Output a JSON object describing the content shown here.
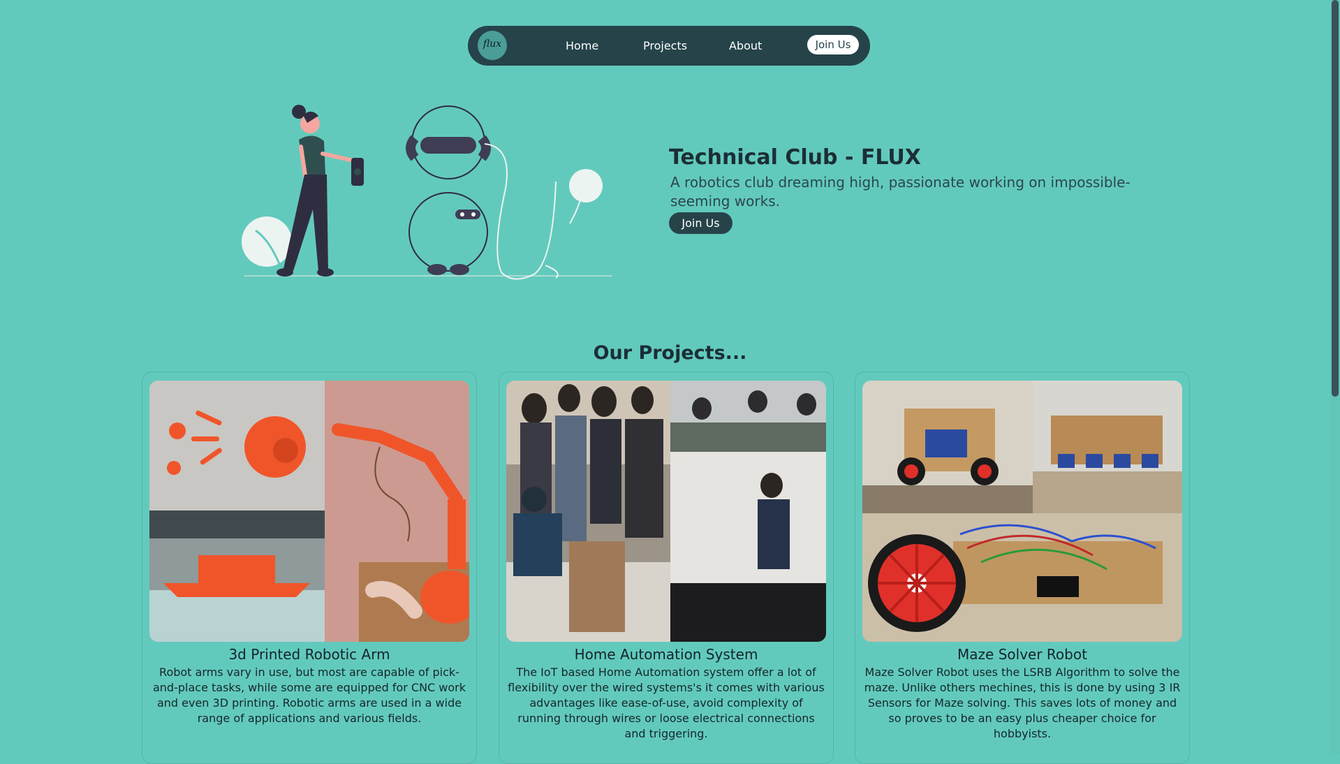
{
  "nav": {
    "logo_text": "flux",
    "links": [
      "Home",
      "Projects",
      "About"
    ],
    "join_label": "Join Us"
  },
  "hero": {
    "title": "Technical Club - FLUX",
    "subtitle": "A robotics club dreaming high, passionate working on impossible-seeming works.",
    "button_label": "Join Us"
  },
  "projects": {
    "heading": "Our Projects...",
    "cards": [
      {
        "title": "3d Printed Robotic Arm",
        "description": "Robot arms vary in use, but most are capable of pick-and-place tasks, while some are equipped for CNC work and even 3D printing. Robotic arms are used in a wide range of applications and various fields."
      },
      {
        "title": "Home Automation System",
        "description": "The IoT based Home Automation system offer a lot of flexibility over the wired systems's it comes with various advantages like ease-of-use, avoid complexity of running through wires or loose electrical connections and triggering."
      },
      {
        "title": "Maze Solver Robot",
        "description": "Maze Solver Robot uses the LSRB Algorithm to solve the maze. Unlike others mechines, this is done by using 3 IR Sensors for Maze solving. This saves lots of money and so proves to be an easy plus cheaper choice for hobbyists."
      }
    ]
  },
  "colors": {
    "background": "#62cabc",
    "nav_dark": "#26434a",
    "accent_orange": "#f0552a",
    "text_dark": "#1b2e36"
  }
}
